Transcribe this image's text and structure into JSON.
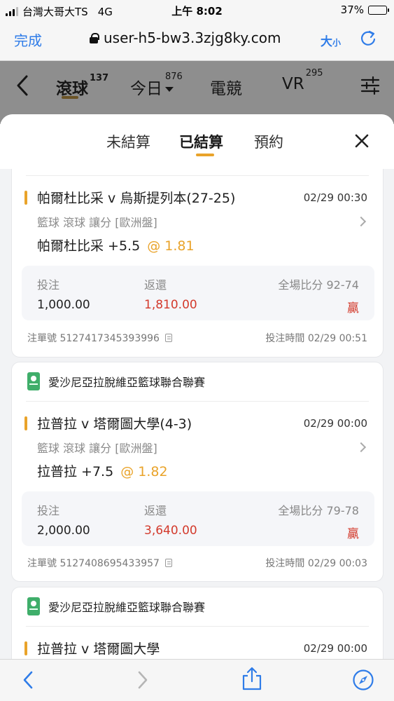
{
  "status_bar": {
    "carrier": "台灣大哥大TS",
    "network": "4G",
    "time": "上午 8:02",
    "battery": "37%",
    "battery_level": 0.37
  },
  "browser": {
    "done_label": "完成",
    "url": "user-h5-bw3.3zjg8ky.com",
    "text_size_label": "大",
    "text_size_small": "小"
  },
  "site_nav": {
    "tabs": [
      {
        "label": "滾球",
        "count": "137",
        "active": true
      },
      {
        "label": "今日",
        "count": "876"
      },
      {
        "label": "電競",
        "count": ""
      },
      {
        "label": "VR",
        "count": "295"
      }
    ]
  },
  "sheet": {
    "tabs": [
      {
        "label": "未結算"
      },
      {
        "label": "已結算",
        "active": true
      },
      {
        "label": "預約"
      }
    ]
  },
  "bets": [
    {
      "league": "",
      "match": "帕爾杜比采 v 烏斯提列本(27-25)",
      "time": "02/29 00:30",
      "meta": "籃球  滾球  讓分  [歐洲盤]",
      "pick": "帕爾杜比采 +5.5",
      "odds": "@ 1.81",
      "stake_label": "投注",
      "stake": "1,000.00",
      "return_label": "返還",
      "return": "1,810.00",
      "score_label": "全場比分 92-74",
      "result": "贏",
      "ticket_label": "注單號 5127417345393996",
      "bet_time_label": "投注時間 02/29 00:51"
    },
    {
      "league": "愛沙尼亞拉脫維亞籃球聯合聯賽",
      "match": "拉普拉 v 塔爾圖大學(4-3)",
      "time": "02/29 00:00",
      "meta": "籃球  滾球  讓分  [歐洲盤]",
      "pick": "拉普拉 +7.5",
      "odds": "@ 1.82",
      "stake_label": "投注",
      "stake": "2,000.00",
      "return_label": "返還",
      "return": "3,640.00",
      "score_label": "全場比分 79-78",
      "result": "贏",
      "ticket_label": "注單號 5127408695433957",
      "bet_time_label": "投注時間 02/29 00:03"
    },
    {
      "league": "愛沙尼亞拉脫維亞籃球聯合聯賽",
      "match": "拉普拉 v 塔爾圖大學",
      "time": "02/29 00:00"
    }
  ],
  "colors": {
    "accent": "#e9a32a",
    "win_red": "#d33a2c",
    "ios_blue": "#2f7ce8"
  },
  "icons": {
    "back": "chevron-left-icon",
    "forward": "chevron-right-icon",
    "share": "share-icon",
    "compass": "compass-icon",
    "reload": "reload-icon",
    "lock": "lock-icon",
    "filter": "filter-icon",
    "close": "close-icon"
  }
}
